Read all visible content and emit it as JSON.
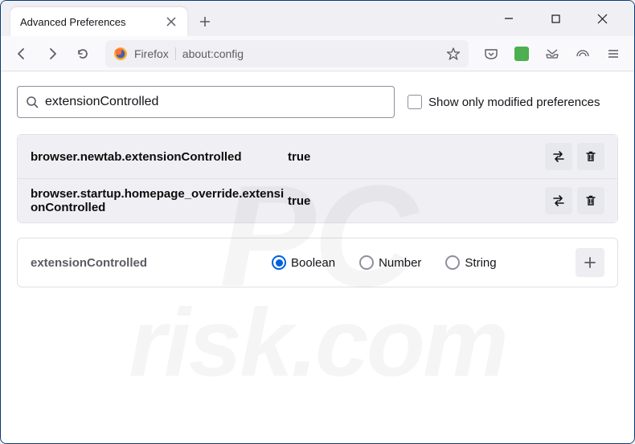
{
  "tab": {
    "title": "Advanced Preferences"
  },
  "urlbar": {
    "identity": "Firefox",
    "url": "about:config"
  },
  "search": {
    "value": "extensionControlled",
    "checkbox_label": "Show only modified preferences"
  },
  "prefs": [
    {
      "name": "browser.newtab.extensionControlled",
      "value": "true"
    },
    {
      "name": "browser.startup.homepage_override.extensionControlled",
      "value": "true"
    }
  ],
  "new_pref": {
    "name": "extensionControlled",
    "types": [
      {
        "label": "Boolean",
        "selected": true
      },
      {
        "label": "Number",
        "selected": false
      },
      {
        "label": "String",
        "selected": false
      }
    ]
  },
  "watermark": {
    "line1": "PC",
    "line2": "risk.com"
  }
}
